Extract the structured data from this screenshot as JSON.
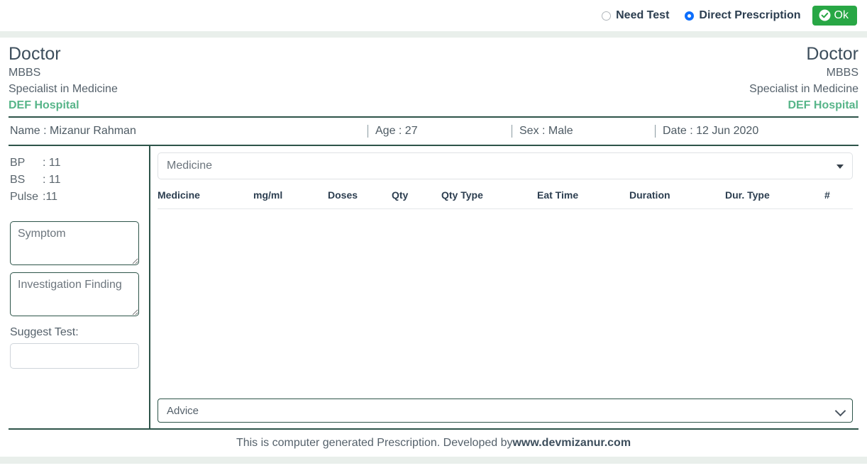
{
  "toolbar": {
    "options": [
      {
        "label": "Need Test",
        "checked": false
      },
      {
        "label": "Direct Prescription",
        "checked": true
      }
    ],
    "ok_label": "Ok",
    "ok_color": "#28a745",
    "radio_checked_color": "#0d6efd"
  },
  "doctor_left": {
    "name": "Doctor",
    "degree": "MBBS",
    "specialty": "Specialist in Medicine",
    "hospital": "DEF Hospital"
  },
  "doctor_right": {
    "name": "Doctor",
    "degree": "MBBS",
    "specialty": "Specialist in Medicine",
    "hospital": "DEF Hospital"
  },
  "hospital_color": "#57b589",
  "patient": {
    "name": "Name : Mizanur Rahman",
    "age": "Age : 27",
    "sex": "Sex : Male",
    "date": "Date : 12 Jun 2020"
  },
  "vitals": [
    {
      "key": "BP",
      "value": ": 11"
    },
    {
      "key": "BS",
      "value": ": 11"
    },
    {
      "key": "Pulse",
      "value": ":11"
    }
  ],
  "left_pane": {
    "symptom_placeholder": "Symptom",
    "symptom_value": "",
    "finding_placeholder": "Investigation Finding",
    "finding_value": "",
    "suggest_test_label": "Suggest Test:",
    "suggest_test_value": "",
    "suggest_test_placeholder": ""
  },
  "medicine": {
    "select_placeholder": "Medicine",
    "columns": [
      "Medicine",
      "mg/ml",
      "Doses",
      "Qty",
      "Qty Type",
      "Eat Time",
      "Duration",
      "Dur. Type",
      "#"
    ],
    "rows": []
  },
  "advice": {
    "selected": "Advice"
  },
  "footer": {
    "text": "This is computer generated Prescription. Developed by ",
    "site": "www.devmizanur.com"
  }
}
